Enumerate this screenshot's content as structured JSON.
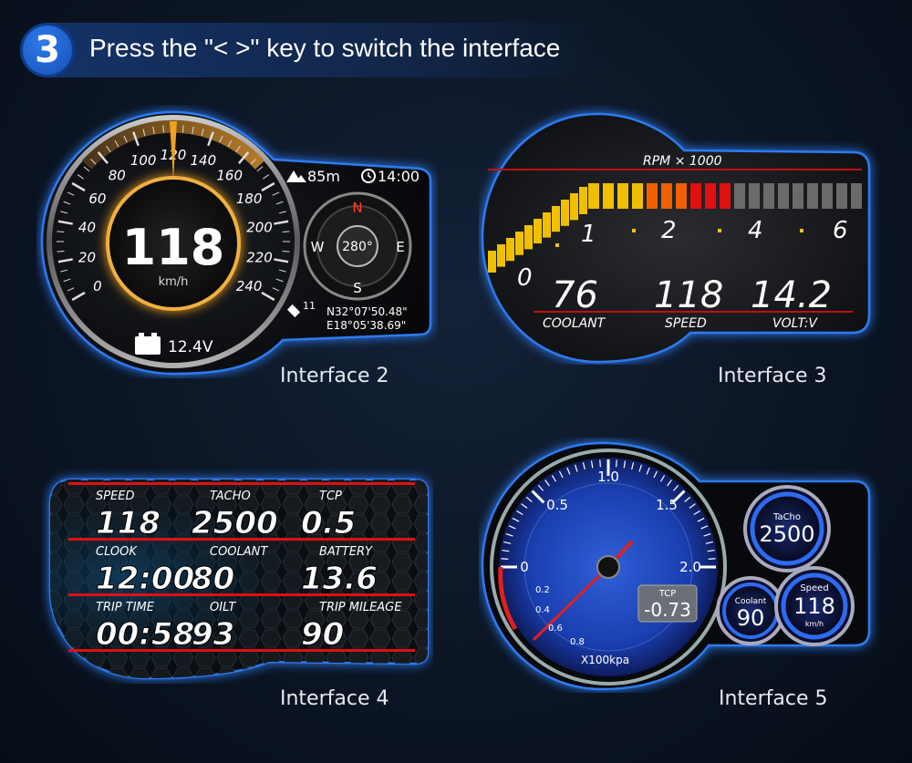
{
  "header": {
    "step_number": "3",
    "instruction": "Press the \"< >\" key to switch the interface"
  },
  "interface2": {
    "caption": "Interface 2",
    "speed_value": "118",
    "speed_unit": "km/h",
    "battery_voltage": "12.4V",
    "altitude": "85m",
    "clock": "14:00",
    "compass_heading": "280°",
    "compass_n": "N",
    "compass_s": "S",
    "compass_e": "E",
    "compass_w": "W",
    "satellites": "11",
    "latitude": "N32°07'50.48\"",
    "longitude": "E18°05'38.69\"",
    "dial_labels": [
      "0",
      "20",
      "40",
      "60",
      "80",
      "100",
      "120",
      "140",
      "160",
      "180",
      "200",
      "220",
      "240"
    ]
  },
  "interface3": {
    "caption": "Interface 3",
    "rpm_label": "RPM × 1000",
    "rpm_ticks": [
      "0",
      "1",
      "2",
      "4",
      "6"
    ],
    "coolant_value": "76",
    "coolant_label": "COOLANT",
    "speed_value": "118",
    "speed_label": "SPEED",
    "volt_value": "14.2",
    "volt_label": "VOLT:V"
  },
  "interface4": {
    "caption": "Interface 4",
    "cells": [
      {
        "label": "SPEED",
        "value": "118"
      },
      {
        "label": "TACHO",
        "value": "2500"
      },
      {
        "label": "TCP",
        "value": "0.5"
      },
      {
        "label": "CLOOK",
        "value": "12:00"
      },
      {
        "label": "COOLANT",
        "value": "80"
      },
      {
        "label": "BATTERY",
        "value": "13.6"
      },
      {
        "label": "TRIP TIME",
        "value": "00:58"
      },
      {
        "label": "OILT",
        "value": "93"
      },
      {
        "label": "TRIP MILEAGE",
        "value": "90"
      }
    ]
  },
  "interface5": {
    "caption": "Interface 5",
    "dial_labels": [
      "0",
      "0.5",
      "1.0",
      "1.5",
      "2.0"
    ],
    "minor_labels": [
      "0.2",
      "0.4",
      "0.6",
      "0.8"
    ],
    "dial_unit": "X100kpa",
    "tcp_label": "TCP",
    "tcp_value": "-0.73",
    "tacho_label": "TaCho",
    "tacho_value": "2500",
    "coolant_label": "Coolant",
    "coolant_value": "90",
    "speed_label": "Speed",
    "speed_value": "118",
    "speed_unit": "km/h"
  },
  "colors": {
    "accent_blue": "#2d7bf0",
    "gold": "#f0a020",
    "red": "#e01010"
  }
}
